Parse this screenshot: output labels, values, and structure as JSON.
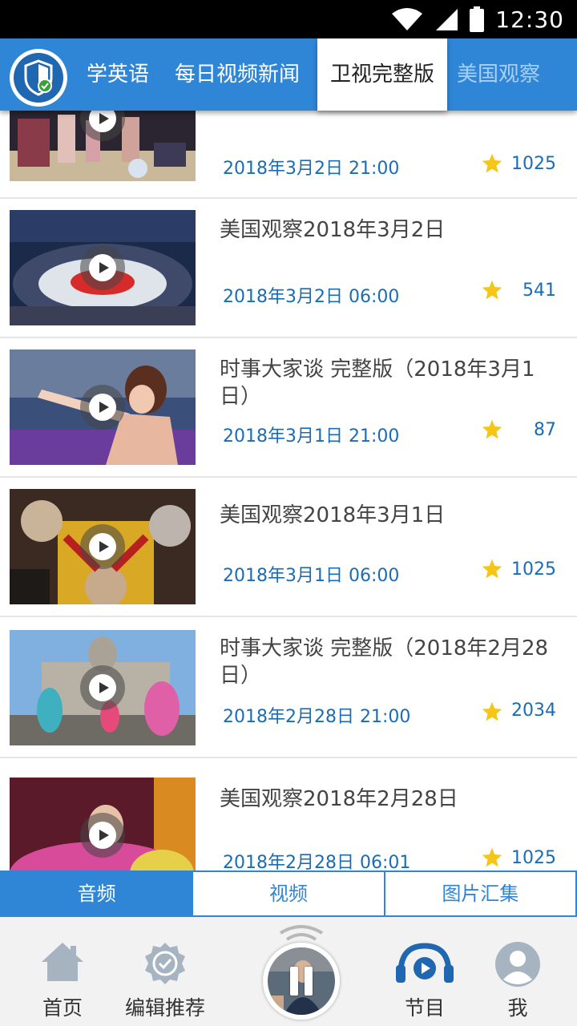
{
  "status_bar": {
    "time": "12:30"
  },
  "top_tabs": [
    "学英语",
    "每日视频新闻",
    "卫视完整版",
    "美国观察"
  ],
  "active_tab": "卫视完整版",
  "videos": [
    {
      "title": "",
      "date": "2018年3月2日 21:00",
      "count": "1025"
    },
    {
      "title": "美国观察2018年3月2日",
      "date": "2018年3月2日 06:00",
      "count": "541"
    },
    {
      "title": "时事大家谈 完整版（2018年3月1日）",
      "date": "2018年3月1日 21:00",
      "count": "87"
    },
    {
      "title": "美国观察2018年3月1日",
      "date": "2018年3月1日 06:00",
      "count": "1025"
    },
    {
      "title": "时事大家谈 完整版（2018年2月28日）",
      "date": "2018年2月28日 21:00",
      "count": "2034"
    },
    {
      "title": "美国观察2018年2月28日",
      "date": "2018年2月28日 06:01",
      "count": "1025"
    }
  ],
  "segment_tabs": [
    "音频",
    "视频",
    "图片汇集"
  ],
  "active_segment": "音频",
  "bottom_nav": {
    "home": "首页",
    "editor_picks": "编辑推荐",
    "programs": "节目",
    "me": "我"
  },
  "icons": {
    "logo": "shield-check-icon",
    "star": "star-icon",
    "play": "play-icon",
    "home": "home-icon",
    "editor_picks": "badge-check-icon",
    "programs": "headphones-play-icon",
    "me": "user-icon",
    "player": "pause-icon"
  },
  "colors": {
    "brand_blue": "#2f86d6",
    "date_blue": "#1a6cb4",
    "star_yellow": "#f5c518",
    "status_bar": "#000000"
  }
}
